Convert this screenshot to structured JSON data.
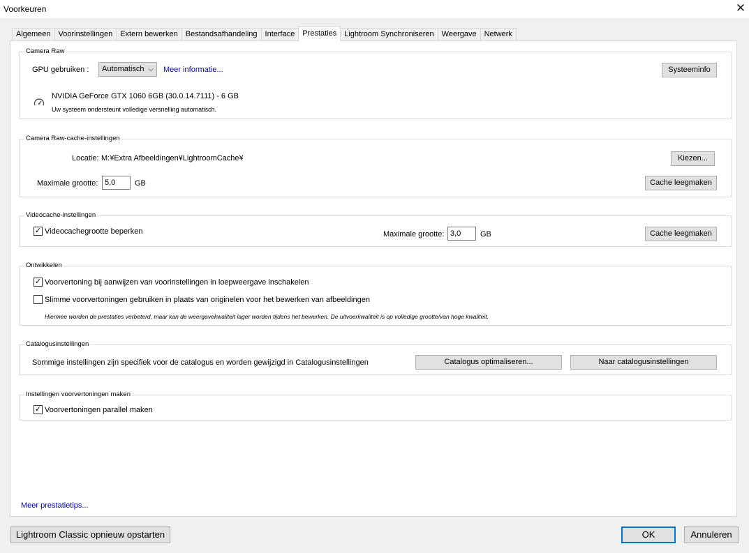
{
  "window": {
    "title": "Voorkeuren",
    "close_icon": "close-icon"
  },
  "tabs": [
    {
      "label": "Algemeen"
    },
    {
      "label": "Voorinstellingen"
    },
    {
      "label": "Extern bewerken"
    },
    {
      "label": "Bestandsafhandeling"
    },
    {
      "label": "Interface"
    },
    {
      "label": "Prestaties",
      "active": true
    },
    {
      "label": "Lightroom Synchroniseren"
    },
    {
      "label": "Weergave"
    },
    {
      "label": "Netwerk"
    }
  ],
  "camera_raw": {
    "legend": "Camera Raw",
    "gpu_label": "GPU gebruiken :",
    "gpu_value": "Automatisch",
    "more_info": "Meer informatie...",
    "system_info_button": "Systeeminfo",
    "gpu_name": "NVIDIA GeForce GTX 1060 6GB (30.0.14.7111) - 6 GB",
    "gpu_status": "Uw systeem ondersteunt volledige versnelling automatisch."
  },
  "cache": {
    "legend": "Camera Raw-cache-instellingen",
    "location_label": "Locatie:",
    "location_value": "M:¥Extra Afbeeldingen¥LightroomCache¥",
    "choose_button": "Kiezen...",
    "max_size_label": "Maximale grootte:",
    "max_size_value": "5,0",
    "unit": "GB",
    "purge_button": "Cache leegmaken"
  },
  "video_cache": {
    "legend": "Videocache-instellingen",
    "limit_label": "Videocachegrootte beperken",
    "limit_checked": true,
    "max_size_label": "Maximale grootte:",
    "max_size_value": "3,0",
    "unit": "GB",
    "purge_button": "Cache leegmaken"
  },
  "develop": {
    "legend": "Ontwikkelen",
    "option1": "Voorvertoning bij aanwijzen van voorinstellingen in loepweergave inschakelen",
    "option1_checked": true,
    "option2": "Slimme voorvertoningen gebruiken in plaats van originelen voor het bewerken van afbeeldingen",
    "option2_checked": false,
    "note": "Hiermee worden de prestaties verbeterd, maar kan de weergavekwaliteit lager worden tijdens het bewerken. De uitvoerkwaliteit is op volledige grootte/van hoge kwaliteit."
  },
  "catalog": {
    "legend": "Catalogusinstellingen",
    "text": "Sommige instellingen zijn specifiek voor de catalogus en worden gewijzigd in Catalogusinstellingen",
    "optimize_button": "Catalogus optimaliseren...",
    "goto_button": "Naar catalogusinstellingen"
  },
  "previews": {
    "legend": "Instellingen voorvertoningen maken",
    "parallel_label": "Voorvertoningen parallel maken",
    "parallel_checked": true
  },
  "footer": {
    "tips_link": "Meer prestatietips...",
    "restart_button": "Lightroom Classic opnieuw opstarten",
    "ok_button": "OK",
    "cancel_button": "Annuleren"
  }
}
